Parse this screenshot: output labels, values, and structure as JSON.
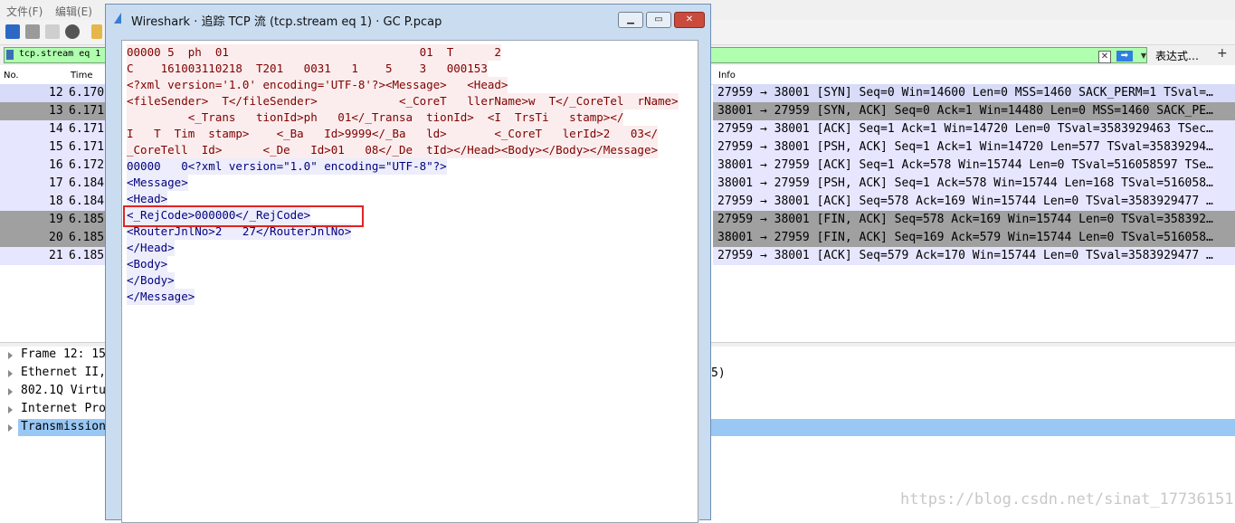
{
  "menu": {
    "items": [
      "文件(F)",
      "编辑(E)"
    ]
  },
  "filter": {
    "value": "tcp.stream eq 1",
    "expression_label": "表达式…",
    "plus_label": "+",
    "clear_label": "✕",
    "apply_label": "➡",
    "dropdown_label": "▼"
  },
  "packet_list": {
    "columns": {
      "no": "No.",
      "time": "Time",
      "info": "Info"
    },
    "rows": [
      {
        "no": "12",
        "time": "6.170",
        "info": "27959 → 38001 [SYN] Seq=0 Win=14600 Len=0 MSS=1460 SACK_PERM=1 TSval=…",
        "style": "syn"
      },
      {
        "no": "13",
        "time": "6.171",
        "info": "38001 → 27959 [SYN, ACK] Seq=0 Ack=1 Win=14480 Len=0 MSS=1460 SACK_PE…",
        "style": "gray"
      },
      {
        "no": "14",
        "time": "6.171",
        "info": "27959 → 38001 [ACK] Seq=1 Ack=1 Win=14720 Len=0 TSval=3583929463 TSec…",
        "style": "light"
      },
      {
        "no": "15",
        "time": "6.171",
        "info": "27959 → 38001 [PSH, ACK] Seq=1 Ack=1 Win=14720 Len=577 TSval=35839294…",
        "style": "light"
      },
      {
        "no": "16",
        "time": "6.172",
        "info": "38001 → 27959 [ACK] Seq=1 Ack=578 Win=15744 Len=0 TSval=516058597 TSe…",
        "style": "light"
      },
      {
        "no": "17",
        "time": "6.184",
        "info": "38001 → 27959 [PSH, ACK] Seq=1 Ack=578 Win=15744 Len=168 TSval=516058…",
        "style": "light"
      },
      {
        "no": "18",
        "time": "6.184",
        "info": "27959 → 38001 [ACK] Seq=578 Ack=169 Win=15744 Len=0 TSval=3583929477 …",
        "style": "light"
      },
      {
        "no": "19",
        "time": "6.185",
        "info": "27959 → 38001 [FIN, ACK] Seq=578 Ack=169 Win=15744 Len=0 TSval=358392…",
        "style": "gray"
      },
      {
        "no": "20",
        "time": "6.185",
        "info": "38001 → 27959 [FIN, ACK] Seq=169 Ack=579 Win=15744 Len=0 TSval=516058…",
        "style": "gray"
      },
      {
        "no": "21",
        "time": "6.185",
        "info": "27959 → 38001 [ACK] Seq=579 Ack=170 Win=15744 Len=0 TSval=3583929477 …",
        "style": "light"
      }
    ]
  },
  "details": {
    "rows": [
      {
        "label": "Frame 12: 15"
      },
      {
        "label": "Ethernet II,"
      },
      {
        "label": "802.1Q Virtu"
      },
      {
        "label": "Internet Pro"
      },
      {
        "label": "Transmission"
      }
    ],
    "right_fragment": "5)"
  },
  "dialog": {
    "title": "Wireshark · 追踪 TCP 流 (tcp.stream eq 1) · GC    P.pcap",
    "btn_min": "▁",
    "btn_max": "▭",
    "btn_close": "✕",
    "lines": [
      {
        "text": "00000 5  ph  01                            01  T      2",
        "side": "client"
      },
      {
        "text": "C    161003110218  T201   0031   1    5    3   000153",
        "side": "client"
      },
      {
        "text": "<?xml version='1.0' encoding='UTF-8'?><Message>   <Head>",
        "side": "client"
      },
      {
        "text": "<fileSender>  T</fileSender>            <_CoreT   llerName>w  T</_CoreTel  rName>",
        "side": "client"
      },
      {
        "text": "         <_Trans   tionId>ph   01</_Transa  tionId>  <I  TrsTi   stamp></",
        "side": "client"
      },
      {
        "text": "I   T  Tim  stamp>    <_Ba   Id>9999</_Ba   ld>       <_CoreT   lerId>2   03</",
        "side": "client"
      },
      {
        "text": "_CoreTell  Id>      <_De   Id>01   08</_De  tId></Head><Body></Body></Message>",
        "side": "client"
      },
      {
        "text": "00000   0<?xml version=\"1.0\" encoding=\"UTF-8\"?>",
        "side": "server"
      },
      {
        "text": "<Message>",
        "side": "server"
      },
      {
        "text": "<Head>",
        "side": "server"
      },
      {
        "text": "<_RejCode>000000</_RejCode>",
        "side": "server"
      },
      {
        "text": "<RouterJnlNo>2   27</RouterJnlNo>",
        "side": "server"
      },
      {
        "text": "</Head>",
        "side": "server"
      },
      {
        "text": "<Body>",
        "side": "server"
      },
      {
        "text": "</Body>",
        "side": "server"
      },
      {
        "text": "</Message>",
        "side": "server"
      }
    ]
  },
  "watermark": "https://blog.csdn.net/sinat_17736151",
  "colors": {
    "syn_row": "#d8dcf8",
    "gray_row": "#a0a0a0",
    "light_row": "#e7e6ff",
    "client_text": "#7f0000",
    "server_text": "#00007f",
    "filter_ok": "#afffaf",
    "highlight_box": "#e02424"
  }
}
